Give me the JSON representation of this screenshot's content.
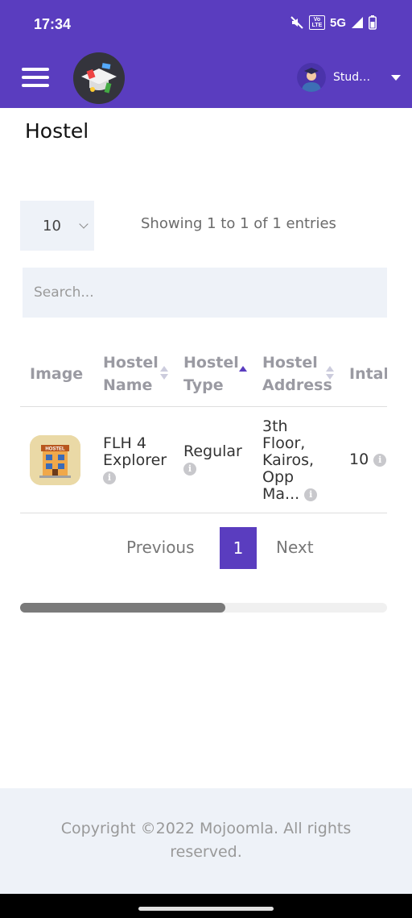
{
  "status_bar": {
    "time": "17:34",
    "network": "5G",
    "volte_label": "Vo LTE"
  },
  "app_bar": {
    "user_name": "Stude..."
  },
  "page": {
    "title": "Hostel"
  },
  "table_controls": {
    "length_value": "10",
    "info_text": "Showing 1 to 1 of 1 entries",
    "search_placeholder": "Search..."
  },
  "table": {
    "columns": [
      {
        "line1": "Image",
        "line2": ""
      },
      {
        "line1": "Hostel",
        "line2": "Name"
      },
      {
        "line1": "Hostel",
        "line2": "Type"
      },
      {
        "line1": "Hostel",
        "line2": "Address"
      },
      {
        "line1": "Intak",
        "line2": ""
      }
    ],
    "sorted_column": "Hostel Type",
    "rows": [
      {
        "image_label": "HOSTEL",
        "name_line1": "FLH 4",
        "name_line2": "Explorer",
        "type": "Regular",
        "address_line1": "3th",
        "address_line2": "Floor,",
        "address_line3": "Kairos,",
        "address_line4": "Opp",
        "address_line5": "Ma...",
        "intake": "10"
      }
    ]
  },
  "pagination": {
    "previous": "Previous",
    "current": "1",
    "next": "Next"
  },
  "footer": {
    "copyright": "Copyright ©2022 Mojoomla. All rights reserved."
  },
  "colors": {
    "primary": "#5a3dbf",
    "panel": "#eef2f8",
    "muted_text": "#9a9aa2"
  },
  "icons": {
    "menu": "hamburger-icon",
    "user_menu": "caret-down-icon",
    "info": "info-circle-icon"
  }
}
